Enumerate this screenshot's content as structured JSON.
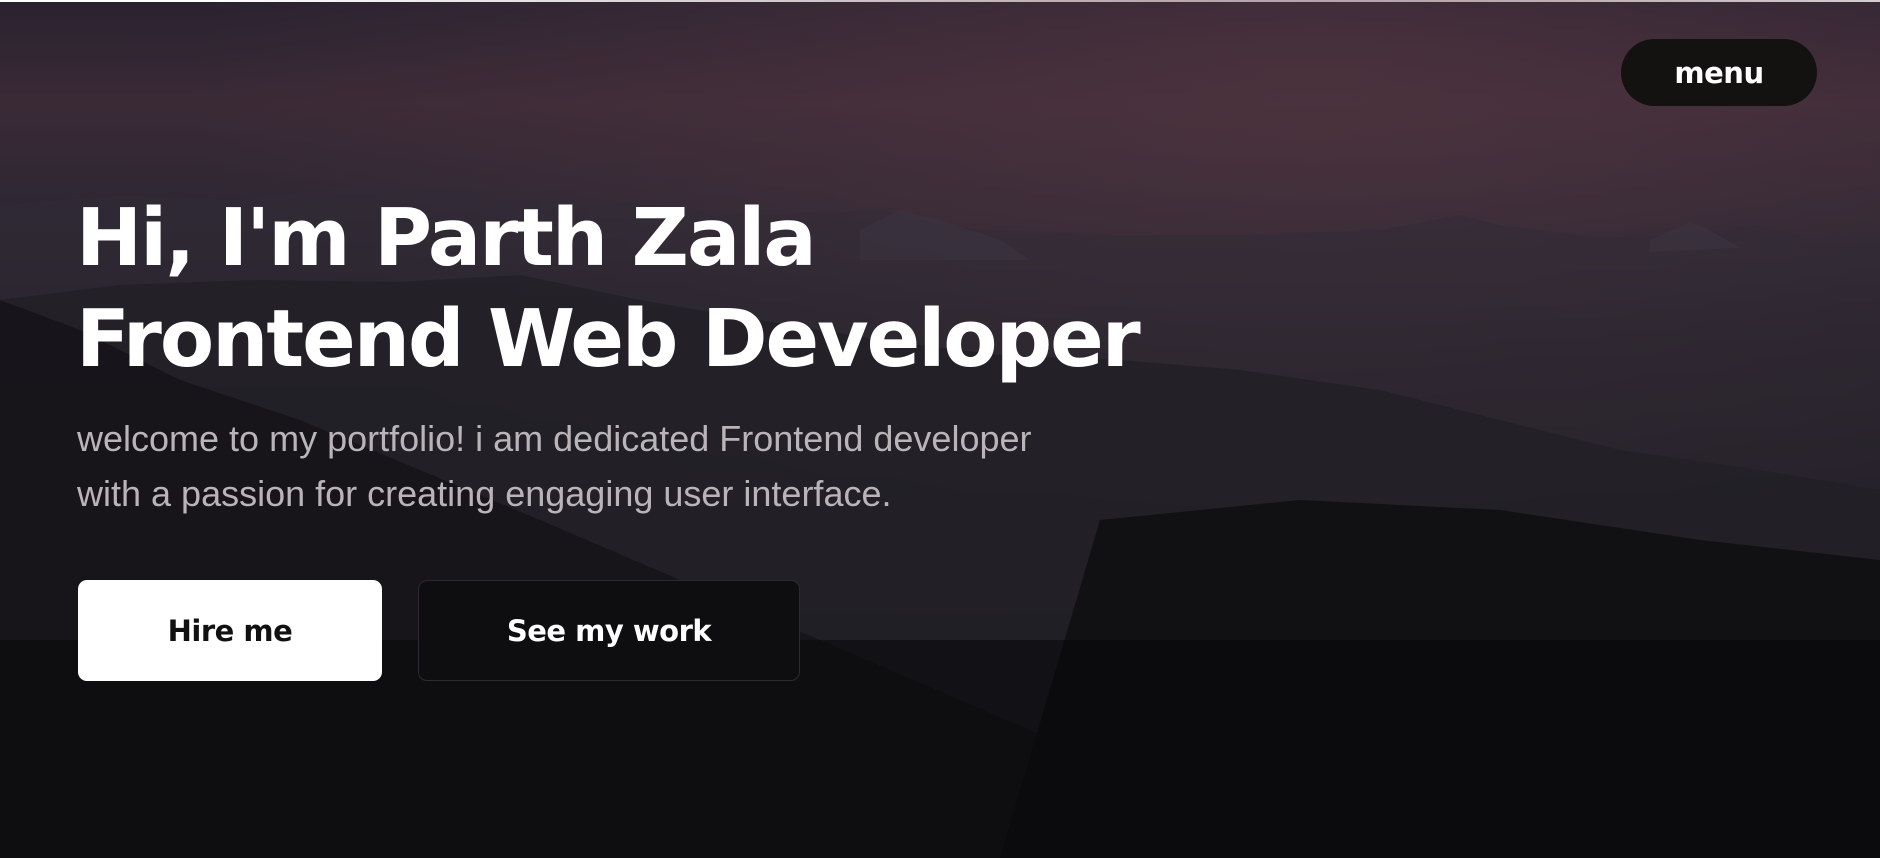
{
  "header": {
    "menu_label": "menu"
  },
  "hero": {
    "headline_line1": "Hi, I'm Parth Zala",
    "headline_line2": "Frontend Web Developer",
    "intro_line1": "welcome to my portfolio! i am dedicated Frontend developer",
    "intro_line2": "with a passion for creating engaging user interface.",
    "background_image": "misty mountain ranges at dusk"
  },
  "actions": {
    "hire_label": "Hire me",
    "work_label": "See my work"
  },
  "colors": {
    "text_primary": "#ffffff",
    "text_muted": "#b9b4b8",
    "menu_bg": "#141111",
    "hire_bg": "#ffffff",
    "work_bg": "#0e0d10"
  }
}
